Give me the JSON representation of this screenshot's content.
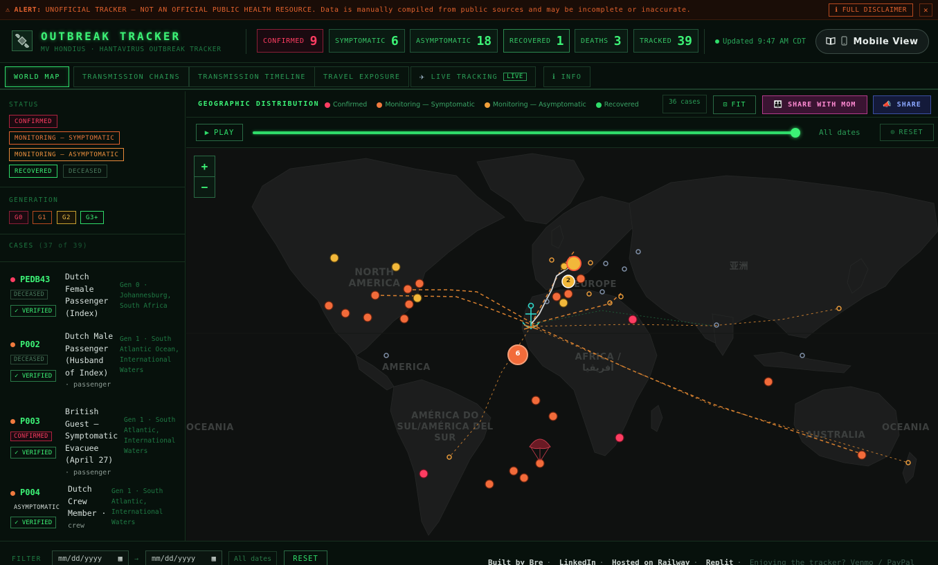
{
  "alert": {
    "icon": "warning-icon",
    "label": "ALERT:",
    "text": "UNOFFICIAL TRACKER — NOT AN OFFICIAL PUBLIC HEALTH RESOURCE. Data is manually compiled from public sources and may be incomplete or inaccurate.",
    "disclaimer_button": "ℹ FULL DISCLAIMER",
    "close": "✕"
  },
  "header": {
    "title": "OUTBREAK TRACKER",
    "subtitle": "MV HONDIUS · HANTAVIRUS OUTBREAK TRACKER",
    "stats": [
      {
        "label": "CONFIRMED",
        "value": "9"
      },
      {
        "label": "SYMPTOMATIC",
        "value": "6"
      },
      {
        "label": "ASYMPTOMATIC",
        "value": "18"
      },
      {
        "label": "RECOVERED",
        "value": "1"
      },
      {
        "label": "DEATHS",
        "value": "3"
      },
      {
        "label": "TRACKED",
        "value": "39"
      }
    ],
    "updated": "Updated 9:47 AM CDT",
    "mobile_view": "Mobile View"
  },
  "tabs": [
    {
      "label": "WORLD MAP"
    },
    {
      "label": "TRANSMISSION CHAINS"
    },
    {
      "label": "TRANSMISSION TIMELINE"
    },
    {
      "label": "TRAVEL EXPOSURE"
    },
    {
      "label": "LIVE TRACKING",
      "badge": "LIVE"
    },
    {
      "label": "ℹ INFO"
    }
  ],
  "sidebar": {
    "status_title": "STATUS",
    "status_chips": [
      "CONFIRMED",
      "MONITORING — SYMPTOMATIC",
      "MONITORING — ASYMPTOMATIC",
      "RECOVERED",
      "DECEASED"
    ],
    "generation_title": "GENERATION",
    "generation_chips": [
      "G0",
      "G1",
      "G2",
      "G3+"
    ],
    "cases_title": "CASES",
    "cases_count": "(37 of 39)",
    "cases": [
      {
        "id": "PEDB43",
        "badge": "DECEASED",
        "verified": "✓ VERIFIED",
        "name": "Dutch Female Passenger (Index)",
        "role": "",
        "gen": "Gen 0 · Johannesburg, South Africa"
      },
      {
        "id": "P002",
        "badge": "DECEASED",
        "verified": "✓ VERIFIED",
        "name": "Dutch Male Passenger (Husband of Index)",
        "role": "· passenger",
        "gen": "Gen 1 · South Atlantic Ocean, International Waters"
      },
      {
        "id": "P003",
        "badge": "CONFIRMED",
        "verified": "✓ VERIFIED",
        "name": "British Guest — Symptomatic Evacuee (April 27)",
        "role": "· passenger",
        "gen": "Gen 1 · South Atlantic, International Waters"
      },
      {
        "id": "P004",
        "badge": "ASYMPTOMATIC",
        "verified": "✓ VERIFIED",
        "name": "Dutch Crew Member ·",
        "role": "crew",
        "gen": "Gen 1 · South Atlantic, International Waters"
      }
    ]
  },
  "map_panel": {
    "title": "GEOGRAPHIC DISTRIBUTION",
    "legend": [
      "Confirmed",
      "Monitoring — Symptomatic",
      "Monitoring — Asymptomatic",
      "Recovered"
    ],
    "cases_count": "36 cases",
    "fit": "FIT",
    "share_mom": "SHARE WITH MOM",
    "share": "SHARE",
    "play": "PLAY",
    "slider_position": 1.0,
    "all_dates": "All dates",
    "reset": "RESET",
    "zoom_in": "+",
    "zoom_out": "−",
    "labels": {
      "north_america": "NORTH AMERICA",
      "europe": "EUROPE",
      "asia": "亚洲",
      "america": "AMERICA",
      "africa": "AFRICA / أفريقيا",
      "south_america": "AMÉRICA DO SUL/AMÉRICA DEL SUR",
      "oceania_left": "OCEANIA",
      "australia": "AUSTRALIA",
      "oceania_right": "OCEANIA"
    },
    "cluster_6": "6",
    "cluster_2": "2"
  },
  "footer": {
    "filter": "FILTER",
    "date_from": "mm/dd/yyyy",
    "date_to": "mm/dd/yyyy",
    "arrow": "→",
    "all_dates": "All dates",
    "reset": "RESET",
    "links": [
      "Built by Bre",
      "LinkedIn",
      "Hosted on Railway",
      "Replit"
    ],
    "support": "Enjoying the tracker? Venmo / PayPal"
  },
  "colors": {
    "accent": "#2fdc6a",
    "confirmed": "#ff3d62",
    "symptomatic": "#f07a3e",
    "asymptomatic": "#f0a03a",
    "recovered": "#2fdc6a"
  }
}
